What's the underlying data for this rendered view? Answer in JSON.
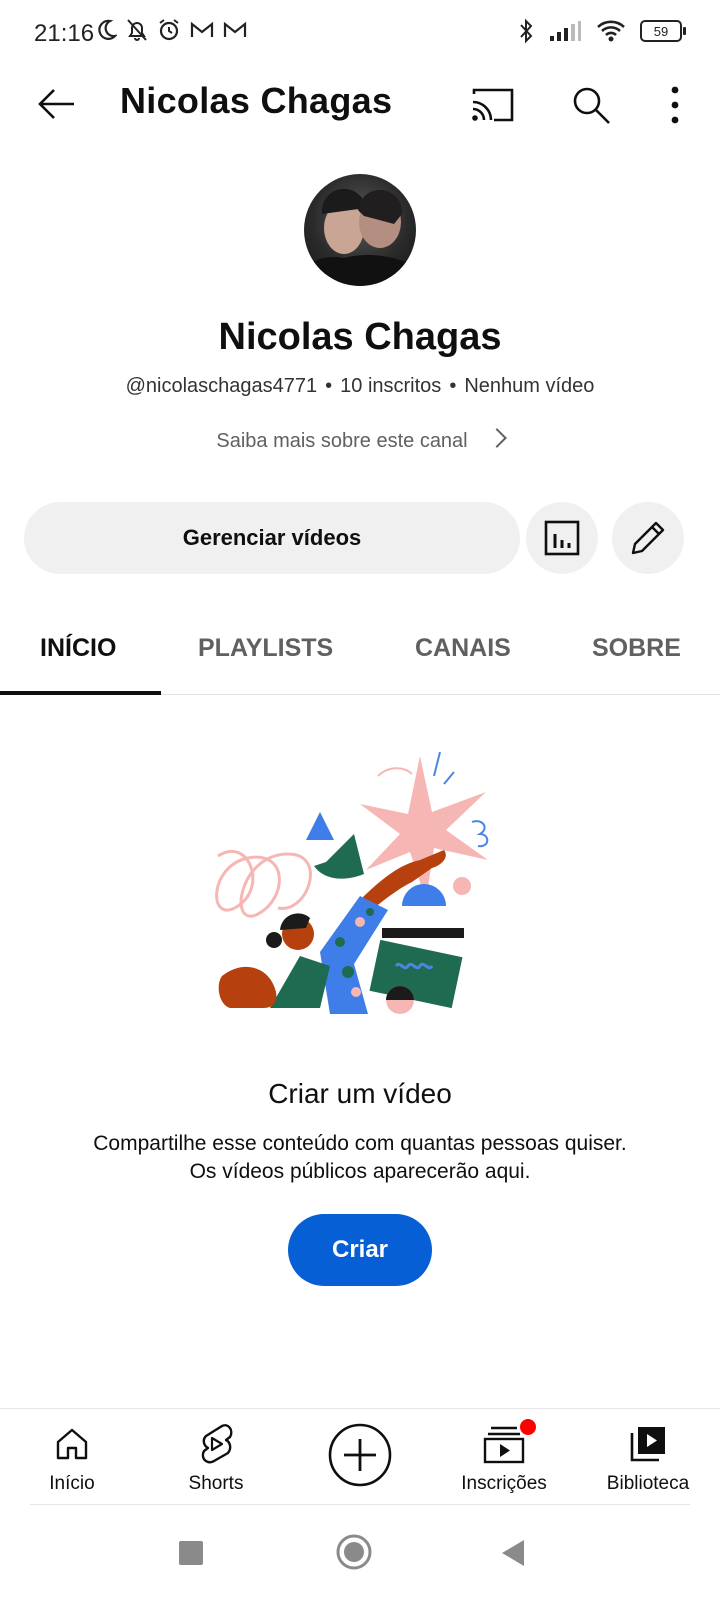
{
  "status_bar": {
    "time": "21:16",
    "battery": "59",
    "left_icons": [
      "moon-icon",
      "bell-off-icon",
      "alarm-icon",
      "gmail-icon",
      "gmail-icon"
    ],
    "right_icons": [
      "bluetooth-icon",
      "signal-icon",
      "wifi-icon",
      "battery-icon"
    ]
  },
  "app_bar": {
    "title": "Nicolas Chagas",
    "icons": [
      "back-arrow-icon",
      "cast-icon",
      "search-icon",
      "more-vert-icon"
    ]
  },
  "channel": {
    "name": "Nicolas Chagas",
    "handle": "@nicolaschagas4771",
    "subscribers": "10 inscritos",
    "videos": "Nenhum vídeo",
    "about_link": "Saiba mais sobre este canal",
    "manage_button": "Gerenciar vídeos",
    "action_icons": [
      "analytics-icon",
      "edit-pencil-icon"
    ]
  },
  "tabs": [
    {
      "label": "INÍCIO",
      "active": true
    },
    {
      "label": "PLAYLISTS",
      "active": false
    },
    {
      "label": "CANAIS",
      "active": false
    },
    {
      "label": "SOBRE",
      "active": false
    }
  ],
  "empty_state": {
    "title": "Criar um vídeo",
    "line1": "Compartilhe esse conteúdo com quantas pessoas quiser.",
    "line2": "Os vídeos públicos aparecerão aqui.",
    "button": "Criar"
  },
  "bottom_nav": [
    {
      "label": "Início",
      "icon": "home-icon"
    },
    {
      "label": "Shorts",
      "icon": "shorts-icon"
    },
    {
      "label": "",
      "icon": "create-plus-icon"
    },
    {
      "label": "Inscrições",
      "icon": "subscriptions-icon",
      "badge": true
    },
    {
      "label": "Biblioteca",
      "icon": "library-icon"
    }
  ],
  "colors": {
    "accent": "#065fd4",
    "badge": "#ff0000",
    "button_bg": "#f0f0f0",
    "text": "#0f0f0f",
    "secondary_text": "#606060"
  }
}
